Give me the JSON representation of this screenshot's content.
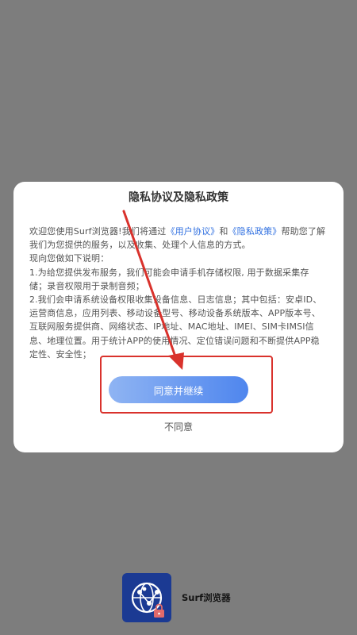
{
  "dialog": {
    "title": "隐私协议及隐私政策",
    "intro_prefix": "欢迎您使用Surf浏览器!我们将通过",
    "user_agreement_link": "《用户协议》",
    "intro_and": "和",
    "privacy_policy_link": "《隐私政策》",
    "intro_suffix": "帮助您了解我们为您提供的服务，以及收集、处理个人信息的方式。",
    "notice_heading": "现向您做如下说明：",
    "item_1": "1.为给您提供发布服务，我们可能会申请手机存储权限, 用于数据采集存储；录音权限用于录制音频；",
    "item_2": "2.我们会申请系统设备权限收集设备信息、日志信息；其中包括：安卓ID、运营商信息，应用列表、移动设备型号、移动设备系统版本、APP版本号、互联网服务提供商、网络状态、IP地址、MAC地址、IMEI、SIM卡IMSI信息、地理位置。用于统计APP的使用情况、定位错误问题和不断提供APP稳定性、安全性；",
    "agree_button": "同意并继续",
    "disagree_button": "不同意"
  },
  "app": {
    "name": "Surf浏览器",
    "icon": "globe-lock-icon"
  },
  "colors": {
    "overlay": "#7d7d7d",
    "link": "#2f6fe0",
    "button_gradient_start": "#8fb4f3",
    "button_gradient_end": "#4f86ee",
    "annotation": "#d9322c",
    "app_icon_bg": "#1b3a93"
  }
}
